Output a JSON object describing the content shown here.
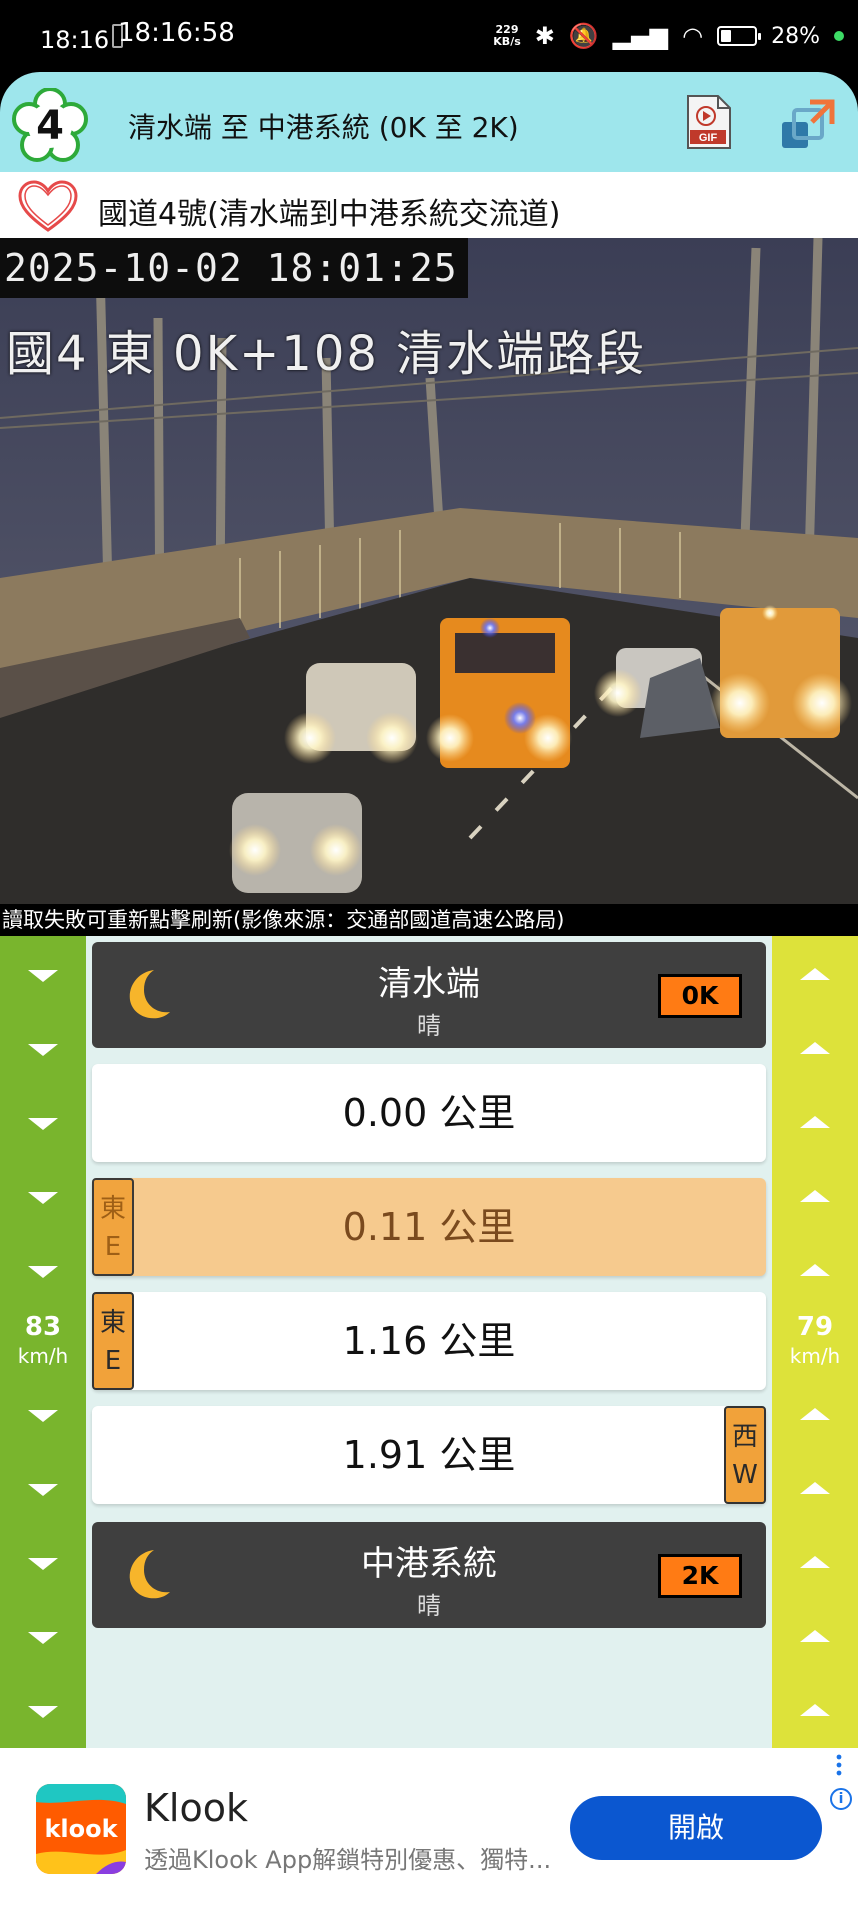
{
  "status_bar": {
    "time": "18:16",
    "overlay_time": "18:16:58",
    "net_speed_value": "229",
    "net_speed_unit": "KB/s",
    "battery_percent": "28%",
    "battery_level": 0.28
  },
  "header": {
    "route_number": "4",
    "title": "清水端 至 中港系統 (0K 至 2K)",
    "gif_icon": "gif-icon",
    "expand_icon": "expand-icon",
    "badge_color": "#2eaa3a"
  },
  "favorite": {
    "icon": "heart-icon",
    "title": "國道4號(清水端到中港系統交流道)"
  },
  "camera": {
    "timestamp": "2025-10-02 18:01:25",
    "location": "國4 東 0K+108 清水端路段",
    "caption": "讀取失敗可重新點擊刷新(影像來源：交通部國道高速公路局)"
  },
  "speeds": {
    "left_value": "83",
    "left_unit": "km/h",
    "right_value": "79",
    "right_unit": "km/h"
  },
  "stations": [
    {
      "name": "清水端",
      "weather": "晴",
      "km": "0K",
      "icon": "moon-icon"
    },
    {
      "name": "中港系統",
      "weather": "晴",
      "km": "2K",
      "icon": "moon-icon"
    }
  ],
  "distances": [
    {
      "value": "0.00 公里"
    },
    {
      "value": "0.11 公里",
      "tag_cn": "東",
      "tag_en": "E"
    },
    {
      "value": "1.16 公里",
      "tag_cn": "東",
      "tag_en": "E"
    },
    {
      "value": "1.91 公里",
      "tag_cn": "西",
      "tag_en": "W"
    }
  ],
  "ad": {
    "logo_text": "klook",
    "title": "Klook",
    "description": "透過Klook App解鎖特別優惠、獨特...",
    "button_label": "開啟",
    "button_color": "#0b57d0"
  },
  "colors": {
    "header_bg": "#9ee6ec",
    "left_strip": "#79b52d",
    "right_strip": "#dde23a",
    "km_badge": "#ff7b14",
    "highlight_row": "#f6ca8e",
    "direction_tag": "#f1a23a"
  }
}
